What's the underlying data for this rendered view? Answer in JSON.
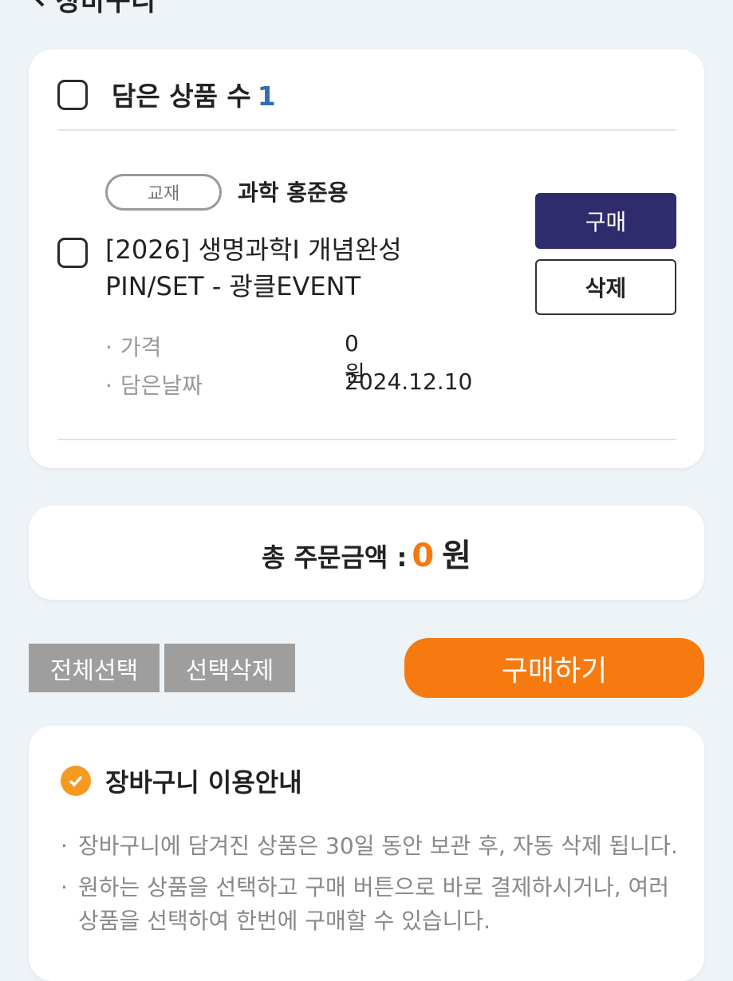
{
  "header": {
    "title": "장바구니"
  },
  "cart": {
    "count_label": "담은 상품 수",
    "count": "1",
    "item": {
      "tag": "교재",
      "teacher": "과학 홍준용",
      "title_line1": "[2026] 생명과학I 개념완성",
      "title_line2": "PIN/SET - 광클EVENT",
      "price_label": "가격",
      "price_value": "0원",
      "date_label": "담은날짜",
      "date_value": "2024.12.10",
      "buy_label": "구매",
      "delete_label": "삭제"
    }
  },
  "total": {
    "label": "총 주문금액 :",
    "amount": "0",
    "unit": "원"
  },
  "actions": {
    "select_all": "전체선택",
    "delete_selected": "선택삭제",
    "purchase": "구매하기"
  },
  "guide": {
    "title": "장바구니 이용안내",
    "items": [
      "장바구니에 담겨진 상품은 30일 동안 보관 후, 자동 삭제 됩니다.",
      "원하는 상품을 선택하고 구매 버튼으로 바로 결제하시거나, 여러 상품을 선택하여 한번에 구매할 수 있습니다."
    ]
  },
  "colors": {
    "accent": "#f67a0f",
    "buy_button": "#2e2c6c",
    "count": "#2f6db3"
  }
}
